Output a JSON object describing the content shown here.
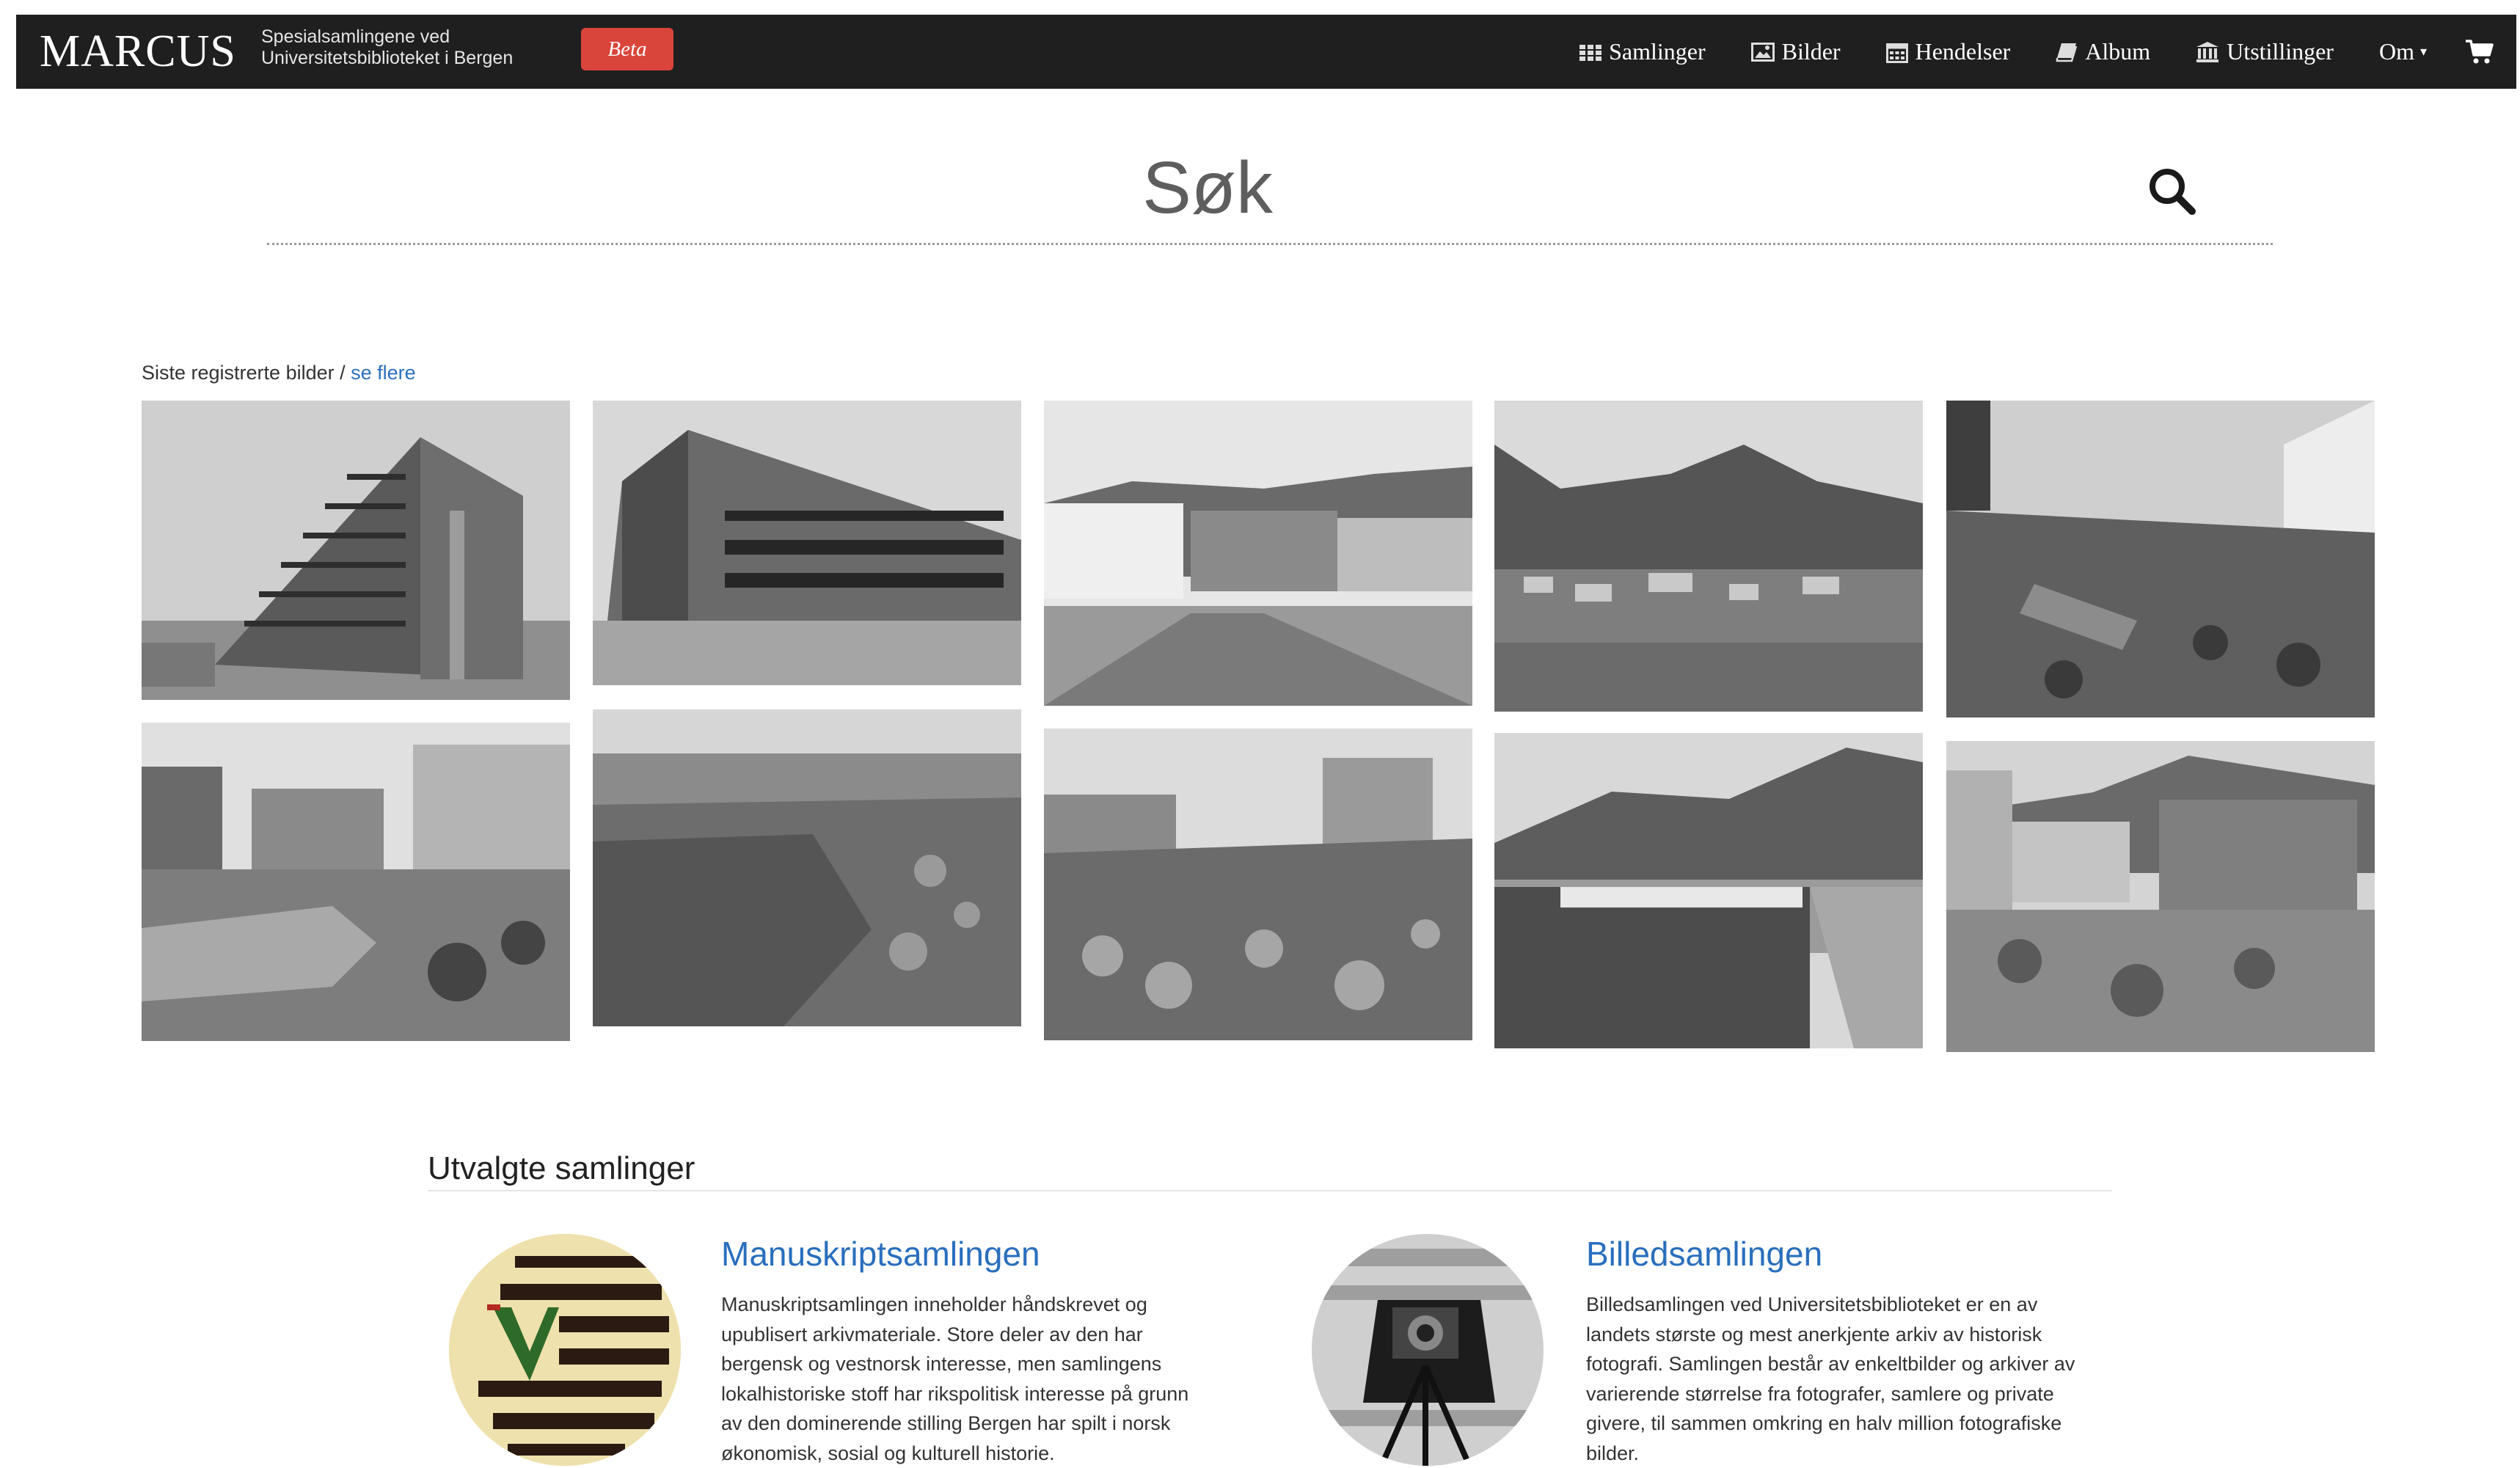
{
  "header": {
    "brand": "MARCUS",
    "subtitle_line1": "Spesialsamlingene ved",
    "subtitle_line2": "Universitetsbiblioteket i Bergen",
    "beta_label": "Beta",
    "nav": [
      {
        "label": "Samlinger",
        "icon": "grid-icon"
      },
      {
        "label": "Bilder",
        "icon": "image-icon"
      },
      {
        "label": "Hendelser",
        "icon": "calendar-icon"
      },
      {
        "label": "Album",
        "icon": "book-icon"
      },
      {
        "label": "Utstillinger",
        "icon": "institution-icon"
      },
      {
        "label": "Om",
        "icon": "caret-down-icon"
      }
    ],
    "cart_icon": "shopping-cart-icon"
  },
  "search": {
    "placeholder": "Søk",
    "button_icon": "search-icon"
  },
  "recent": {
    "label": "Siste registrerte bilder /",
    "link": "se flere",
    "photos": [
      "photo-1",
      "photo-2",
      "photo-3",
      "photo-4",
      "photo-5",
      "photo-6",
      "photo-7",
      "photo-8",
      "photo-9",
      "photo-10"
    ]
  },
  "featured": {
    "title": "Utvalgte samlinger",
    "collections": [
      {
        "title": "Manuskriptsamlingen",
        "lines": [
          "Manuskriptsamlingen inneholder håndskrevet og",
          "upublisert arkivmateriale. Store deler av den har",
          "bergensk og vestnorsk interesse, men samlingens",
          "lokalhistoriske stoff har rikspolitisk interesse på grunn",
          "av den dominerende stilling Bergen har spilt i norsk",
          "økonomisk, sosial og kulturell historie."
        ]
      },
      {
        "title": "Billedsamlingen",
        "lines": [
          "Billedsamlingen ved Universitetsbiblioteket er en av",
          "landets største og mest anerkjente arkiv av historisk",
          "fotografi. Samlingen består av enkeltbilder og arkiver av",
          "varierende størrelse fra fotografer, samlere og private",
          "givere, til sammen omkring en halv million fotografiske",
          "bilder."
        ]
      }
    ]
  },
  "colors": {
    "navbar": "#1f1f1f",
    "beta": "#d9453a",
    "link": "#2a6fbd"
  }
}
